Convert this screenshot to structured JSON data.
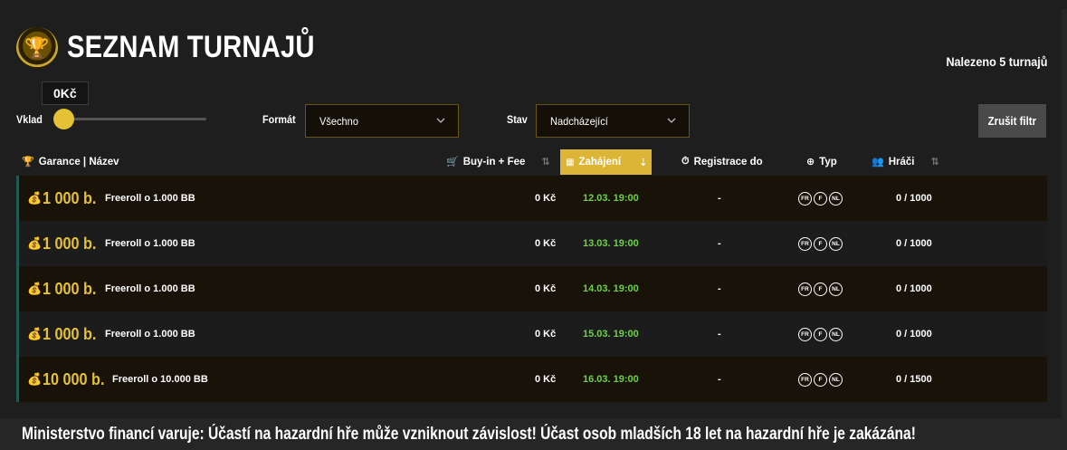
{
  "header": {
    "title": "SEZNAM TURNAJŮ",
    "found_count": "Nalezeno 5 turnajů",
    "icon": "trophy-chip-icon"
  },
  "filters": {
    "deposit_label": "Vklad",
    "deposit_value": "0Kč",
    "deposit_level": 0,
    "format_label": "Formát",
    "format_value": "Všechno",
    "status_label": "Stav",
    "status_value": "Nadcházející",
    "reset_label": "Zrušit filtr",
    "accent_color": "#e4c135"
  },
  "columns": {
    "name": "Garance | Název",
    "buyin": "Buy-in + Fee",
    "start": "Zahájení",
    "registration": "Registrace do",
    "type": "Typ",
    "players": "Hráči"
  },
  "tournaments": [
    {
      "guarantee": "1 000 b.",
      "name": "Freeroll o 1.000 BB",
      "buyin": "0 Kč",
      "start": "12.03. 19:00",
      "registration": "-",
      "types": [
        "FR",
        "F",
        "NL"
      ],
      "players": "0 / 1000"
    },
    {
      "guarantee": "1 000 b.",
      "name": "Freeroll o 1.000 BB",
      "buyin": "0 Kč",
      "start": "13.03. 19:00",
      "registration": "-",
      "types": [
        "FR",
        "F",
        "NL"
      ],
      "players": "0 / 1000"
    },
    {
      "guarantee": "1 000 b.",
      "name": "Freeroll o 1.000 BB",
      "buyin": "0 Kč",
      "start": "14.03. 19:00",
      "registration": "-",
      "types": [
        "FR",
        "F",
        "NL"
      ],
      "players": "0 / 1000"
    },
    {
      "guarantee": "1 000 b.",
      "name": "Freeroll o 1.000 BB",
      "buyin": "0 Kč",
      "start": "15.03. 19:00",
      "registration": "-",
      "types": [
        "FR",
        "F",
        "NL"
      ],
      "players": "0 / 1000"
    },
    {
      "guarantee": "10 000 b.",
      "name": "Freeroll o 10.000 BB",
      "buyin": "0 Kč",
      "start": "16.03. 19:00",
      "registration": "-",
      "types": [
        "FR",
        "F",
        "NL"
      ],
      "players": "0 / 1500"
    }
  ],
  "warning": "Ministerstvo financí varuje: Účastí na hazardní hře může vzniknout závislost! Účast osob mladších 18 let na hazardní hře je zakázána!"
}
